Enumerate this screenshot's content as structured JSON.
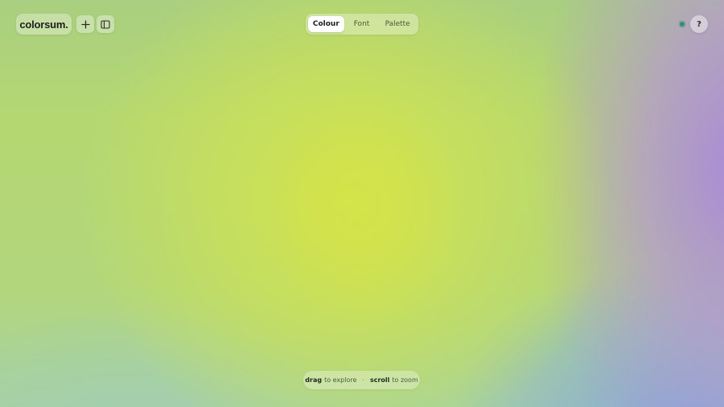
{
  "app": {
    "logo_text": "colorsum."
  },
  "toolbar": {
    "add_icon": "plus-icon",
    "panel_icon": "sidebar-panel-icon"
  },
  "tabs": [
    {
      "label": "Colour",
      "active": true
    },
    {
      "label": "Font",
      "active": false
    },
    {
      "label": "Palette",
      "active": false
    }
  ],
  "status": {
    "indicator_color": "#2f8f7a"
  },
  "help": {
    "label": "?"
  },
  "hint": {
    "drag_key": "drag",
    "drag_text": "to explore",
    "separator": "·",
    "scroll_key": "scroll",
    "scroll_text": "to zoom"
  },
  "colors": {
    "center": "#d2e24c",
    "right_edge": "#a98ad8",
    "bottom_right": "#86a6d8",
    "background": "#b2d67c"
  }
}
